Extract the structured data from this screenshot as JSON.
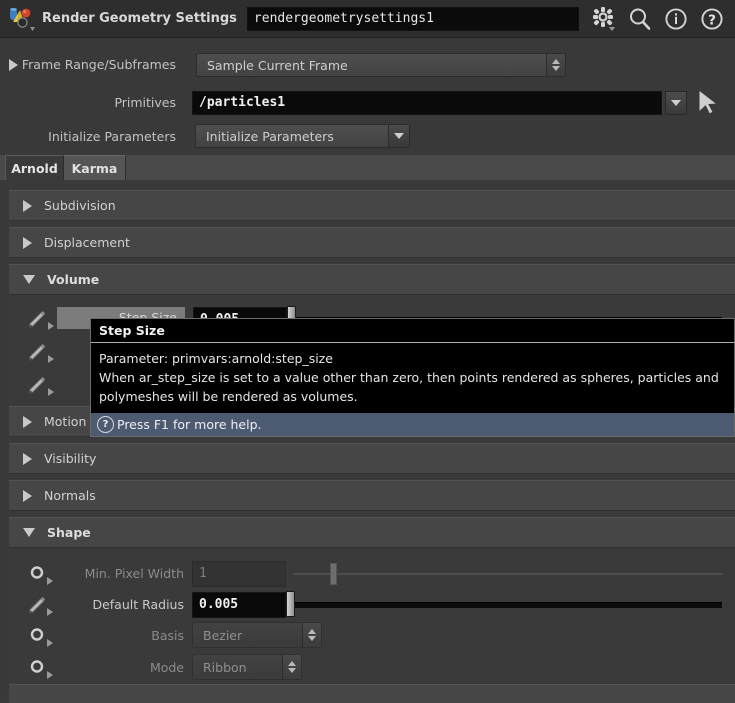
{
  "window": {
    "node_icon": "geometry-node-icon",
    "title": "Render Geometry Settings",
    "name_value": "rendergeometrysettings1",
    "icons": [
      "gear-icon",
      "search-icon",
      "info-icon",
      "help-icon"
    ]
  },
  "top_params": [
    {
      "label": "Frame Range/Subframes",
      "control": "combo-spinner",
      "value": "Sample Current Frame",
      "expandable": true
    },
    {
      "label": "Primitives",
      "control": "text-field",
      "value": "/particles1",
      "has_dropdown": true,
      "has_picker": true
    },
    {
      "label": "Initialize Parameters",
      "control": "menu-button",
      "value": "Initialize Parameters"
    }
  ],
  "tabs": [
    {
      "label": "Arnold",
      "active": true
    },
    {
      "label": "Karma",
      "active": false
    }
  ],
  "sections": [
    {
      "title": "Subdivision",
      "open": false
    },
    {
      "title": "Displacement",
      "open": false
    },
    {
      "title": "Volume",
      "open": true
    },
    {
      "title": "Motion B",
      "open": false
    },
    {
      "title": "Visibility",
      "open": false
    },
    {
      "title": "Normals",
      "open": false
    },
    {
      "title": "Shape",
      "open": true
    }
  ],
  "volume_rows": [
    {
      "icon": "pencil-icon",
      "label": "Step Size",
      "value": "0.005",
      "hovered": true,
      "slider_pos": 0.0
    },
    {
      "icon": "pencil-icon",
      "label": "",
      "value": "",
      "hovered": false
    },
    {
      "icon": "pencil-icon",
      "label": "",
      "value": "",
      "hovered": false
    }
  ],
  "shape_rows": [
    {
      "icon": "ring-icon",
      "label": "Min. Pixel Width",
      "control": "number",
      "value": "1",
      "enabled": false,
      "slider_pos": 0.115
    },
    {
      "icon": "pencil-icon",
      "label": "Default Radius",
      "control": "number",
      "value": "0.005",
      "enabled": true,
      "slider_pos": 0.0
    },
    {
      "icon": "ring-icon",
      "label": "Basis",
      "control": "menu",
      "value": "Bezier",
      "enabled": false
    },
    {
      "icon": "ring-icon",
      "label": "Mode",
      "control": "menu",
      "value": "Ribbon",
      "enabled": false
    }
  ],
  "tooltip": {
    "title": "Step Size",
    "parameter_line": "Parameter: primvars:arnold:step_size",
    "description_line_1": "When ar_step_size is set to a value other than zero, then points rendered as spheres, particles and",
    "description_line_2": "polymeshes will be rendered as volumes.",
    "footer": "Press F1 for more help.",
    "footer_icon": "question-circle-icon",
    "footer_color": "#4c5a72"
  },
  "colors": {
    "panel_bg": "#3a3a3a",
    "titlebar_bg": "#2e2e2e",
    "section_bg": "#464646",
    "field_bg": "#090909",
    "accent": "#4c5a72"
  }
}
